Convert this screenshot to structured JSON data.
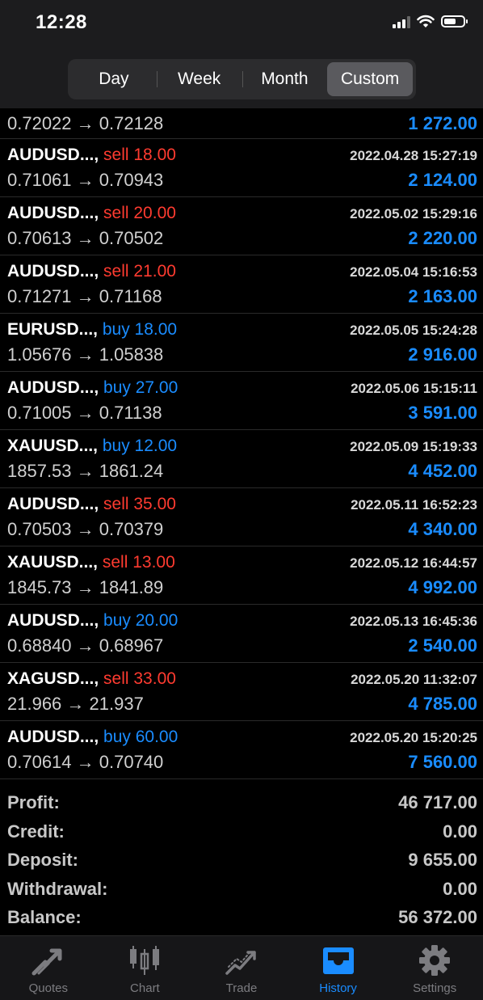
{
  "status_bar": {
    "time": "12:28"
  },
  "period_tabs": [
    "Day",
    "Week",
    "Month",
    "Custom"
  ],
  "active_period": "Custom",
  "first_row": {
    "prices": "0.72022 → 0.72128",
    "profit": "1 272.00"
  },
  "trades": [
    {
      "symbol": "AUDUSD...,",
      "side": "sell",
      "volume": "sell 18.00",
      "datetime": "2022.04.28 15:27:19",
      "prices": "0.71061 → 0.70943",
      "profit": "2 124.00"
    },
    {
      "symbol": "AUDUSD...,",
      "side": "sell",
      "volume": "sell 20.00",
      "datetime": "2022.05.02 15:29:16",
      "prices": "0.70613 → 0.70502",
      "profit": "2 220.00"
    },
    {
      "symbol": "AUDUSD...,",
      "side": "sell",
      "volume": "sell 21.00",
      "datetime": "2022.05.04 15:16:53",
      "prices": "0.71271 → 0.71168",
      "profit": "2 163.00"
    },
    {
      "symbol": "EURUSD...,",
      "side": "buy",
      "volume": "buy 18.00",
      "datetime": "2022.05.05 15:24:28",
      "prices": "1.05676 → 1.05838",
      "profit": "2 916.00"
    },
    {
      "symbol": "AUDUSD...,",
      "side": "buy",
      "volume": "buy 27.00",
      "datetime": "2022.05.06 15:15:11",
      "prices": "0.71005 → 0.71138",
      "profit": "3 591.00"
    },
    {
      "symbol": "XAUUSD...,",
      "side": "buy",
      "volume": "buy 12.00",
      "datetime": "2022.05.09 15:19:33",
      "prices": "1857.53 → 1861.24",
      "profit": "4 452.00"
    },
    {
      "symbol": "AUDUSD...,",
      "side": "sell",
      "volume": "sell 35.00",
      "datetime": "2022.05.11 16:52:23",
      "prices": "0.70503 → 0.70379",
      "profit": "4 340.00"
    },
    {
      "symbol": "XAUUSD...,",
      "side": "sell",
      "volume": "sell 13.00",
      "datetime": "2022.05.12 16:44:57",
      "prices": "1845.73 → 1841.89",
      "profit": "4 992.00"
    },
    {
      "symbol": "AUDUSD...,",
      "side": "buy",
      "volume": "buy 20.00",
      "datetime": "2022.05.13 16:45:36",
      "prices": "0.68840 → 0.68967",
      "profit": "2 540.00"
    },
    {
      "symbol": "XAGUSD...,",
      "side": "sell",
      "volume": "sell 33.00",
      "datetime": "2022.05.20 11:32:07",
      "prices": "21.966 → 21.937",
      "profit": "4 785.00"
    },
    {
      "symbol": "AUDUSD...,",
      "side": "buy",
      "volume": "buy 60.00",
      "datetime": "2022.05.20 15:20:25",
      "prices": "0.70614 → 0.70740",
      "profit": "7 560.00"
    }
  ],
  "summary": [
    {
      "label": "Profit:",
      "value": "46 717.00"
    },
    {
      "label": "Credit:",
      "value": "0.00"
    },
    {
      "label": "Deposit:",
      "value": "9 655.00"
    },
    {
      "label": "Withdrawal:",
      "value": "0.00"
    },
    {
      "label": "Balance:",
      "value": "56 372.00"
    }
  ],
  "bottom_tabs": [
    {
      "label": "Quotes",
      "icon": "quotes-icon"
    },
    {
      "label": "Chart",
      "icon": "candlestick-chart-icon"
    },
    {
      "label": "Trade",
      "icon": "trade-icon"
    },
    {
      "label": "History",
      "icon": "inbox-history-icon"
    },
    {
      "label": "Settings",
      "icon": "gear-icon"
    }
  ],
  "active_tab": "History",
  "colors": {
    "buy": "#1a8cff",
    "sell": "#ff3b30",
    "profit": "#1a8cff",
    "active_tab": "#1a8cff"
  }
}
